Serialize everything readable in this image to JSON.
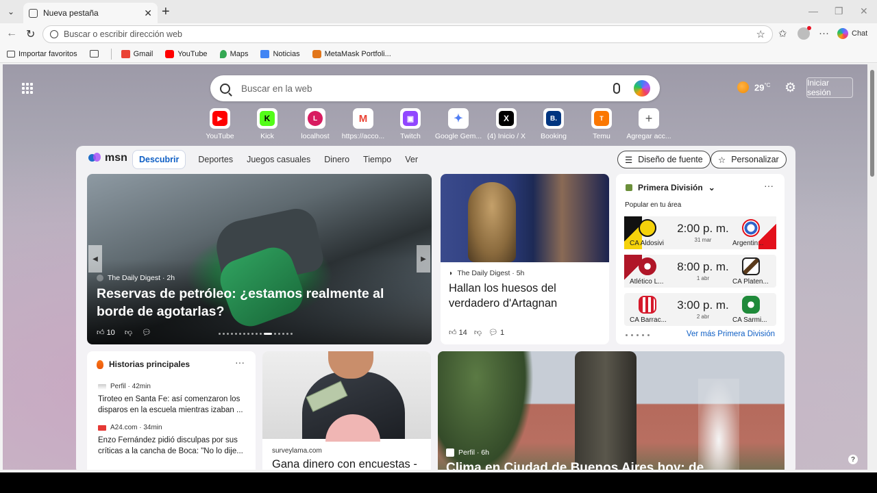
{
  "tab": {
    "title": "Nueva pestaña"
  },
  "address": {
    "placeholder": "Buscar o escribir dirección web"
  },
  "toolbar": {
    "chat_label": "Chat"
  },
  "bookmarks": [
    {
      "label": "Importar favoritos",
      "icon": "import-icon",
      "color": "#444444"
    },
    {
      "label": "Gmail",
      "icon": "gmail-icon",
      "color": "#ea4335"
    },
    {
      "label": "YouTube",
      "icon": "youtube-icon",
      "color": "#ff0000"
    },
    {
      "label": "Maps",
      "icon": "maps-icon",
      "color": "#34a853"
    },
    {
      "label": "Noticias",
      "icon": "news-icon",
      "color": "#4285f4"
    },
    {
      "label": "MetaMask Portfoli...",
      "icon": "metamask-icon",
      "color": "#e2761b"
    }
  ],
  "ntp": {
    "search_placeholder": "Buscar en la web",
    "weather_temp": "29",
    "weather_unit": "°C",
    "signin_label": "Iniciar sesión"
  },
  "quick_links": [
    {
      "label": "YouTube",
      "glyph": "▶",
      "color": "#ff0000"
    },
    {
      "label": "Kick",
      "glyph": "K",
      "color": "#53fc18"
    },
    {
      "label": "localhost",
      "glyph": "L",
      "color": "#d81b60"
    },
    {
      "label": "https://acco...",
      "glyph": "M",
      "color": "#ea4335"
    },
    {
      "label": "Twitch",
      "glyph": "▣",
      "color": "#9146ff"
    },
    {
      "label": "Google Gem...",
      "glyph": "✦",
      "color": "#4f7df3"
    },
    {
      "label": "(4) Inicio / X",
      "glyph": "X",
      "color": "#000000"
    },
    {
      "label": "Booking",
      "glyph": "B.",
      "color": "#003580"
    },
    {
      "label": "Temu",
      "glyph": "T",
      "color": "#fb7701"
    },
    {
      "label": "Agregar acc...",
      "glyph": "+",
      "color": "#ffffff"
    }
  ],
  "feed": {
    "brand": "msn",
    "tabs": [
      "Descubrir",
      "Deportes",
      "Juegos casuales",
      "Dinero",
      "Tiempo",
      "Ver"
    ],
    "font_design_label": "Diseño de fuente",
    "personalize_label": "Personalizar",
    "hero": {
      "source": "The Daily Digest · 2h",
      "title": "Reservas de petróleo: ¿estamos realmente al borde de agotarlas?",
      "likes": "10"
    },
    "card2": {
      "source": "The Daily Digest · 5h",
      "title": "Hallan los huesos del verdadero d'Artagnan",
      "likes": "14",
      "comments": "1"
    },
    "sports": {
      "league": "Primera División",
      "subtitle": "Popular en tu área",
      "link": "Ver más Primera División",
      "matches": [
        {
          "home": "CA Aldosivi",
          "away": "Argentin...",
          "time": "2:00 p. m.",
          "date": "31 mar"
        },
        {
          "home": "Atlético L...",
          "away": "CA Platen...",
          "time": "8:00 p. m.",
          "date": "1 abr"
        },
        {
          "home": "CA Barrac...",
          "away": "CA Sarmi...",
          "time": "3:00 p. m.",
          "date": "2 abr"
        }
      ]
    },
    "top_stories": {
      "heading": "Historias principales",
      "items": [
        {
          "source": "Perfil · 42min",
          "title": "Tiroteo en Santa Fe: así comenzaron los disparos en la escuela mientras izaban ..."
        },
        {
          "source": "A24.com · 34min",
          "title": "Enzo Fernández pidió disculpas por sus críticas a la cancha de Boca: \"No lo dije..."
        }
      ]
    },
    "card4": {
      "source": "surveylama.com",
      "title": "Gana dinero con encuestas -"
    },
    "card5": {
      "source": "Perfil · 6h",
      "title": "Clima en Ciudad de Buenos Aires hoy: de"
    }
  }
}
